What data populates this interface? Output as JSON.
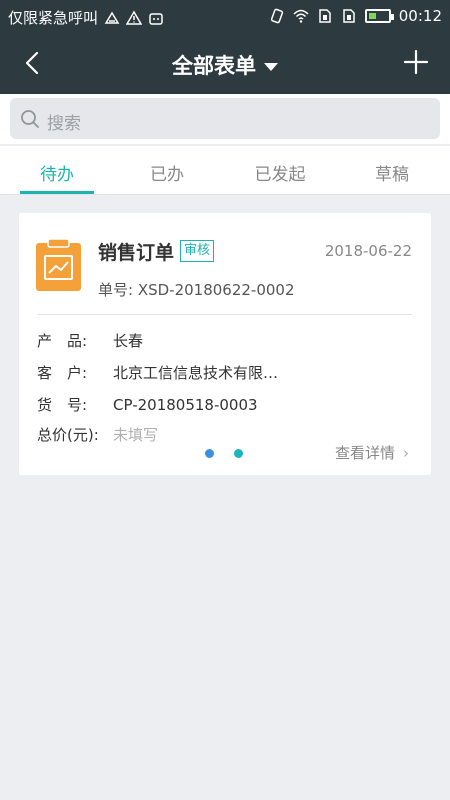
{
  "status_bar": {
    "carrier": "仅限紧急呼叫",
    "time": "00:12",
    "battery_level": 0.4
  },
  "header": {
    "title": "全部表单",
    "back_icon": "back-chevron-icon",
    "add_icon": "plus-icon"
  },
  "search": {
    "placeholder": "搜索"
  },
  "tabs": [
    {
      "label": "待办",
      "active": true
    },
    {
      "label": "已办",
      "active": false
    },
    {
      "label": "已发起",
      "active": false
    },
    {
      "label": "草稿",
      "active": false
    }
  ],
  "card": {
    "title": "销售订单",
    "badge": "审核",
    "date": "2018-06-22",
    "order_no": "单号: XSD-20180622-0002",
    "icon_color": "#f5a13a",
    "fields": [
      {
        "label": "产　品:",
        "value": "长春",
        "muted": false
      },
      {
        "label": "客　户:",
        "value": "北京工信信息技术有限…",
        "muted": false
      },
      {
        "label": "货　号:",
        "value": "CP-20180518-0003",
        "muted": false
      },
      {
        "label": "总价(元):",
        "value": "未填写",
        "muted": true
      }
    ],
    "pager": {
      "active_index": 0,
      "count": 2,
      "colors": [
        "#3b8fe0",
        "#1cb4c0"
      ]
    },
    "detail_link": "查看详情"
  },
  "colors": {
    "accent": "#1cb4b0",
    "header_bg": "#2d3a3f"
  }
}
